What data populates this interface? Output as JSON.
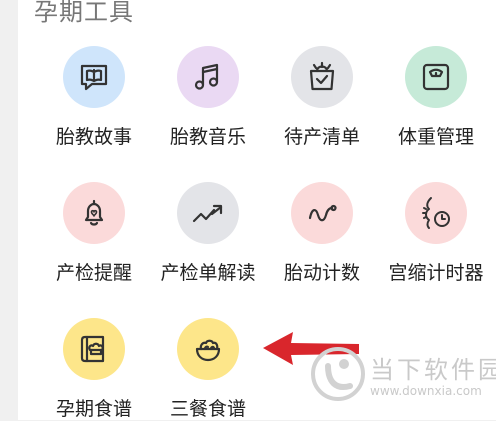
{
  "section": {
    "title": "孕期工具"
  },
  "tools": [
    {
      "label": "胎教故事",
      "icon": "book-chat-icon",
      "bg": "#cfe5fb"
    },
    {
      "label": "胎教音乐",
      "icon": "music-note-icon",
      "bg": "#ead9f3"
    },
    {
      "label": "待产清单",
      "icon": "shopping-bag-icon",
      "bg": "#e3e4e8"
    },
    {
      "label": "体重管理",
      "icon": "scale-icon",
      "bg": "#c6ead8"
    },
    {
      "label": "产检提醒",
      "icon": "bell-icon",
      "bg": "#fbdada"
    },
    {
      "label": "产检单解读",
      "icon": "trend-up-icon",
      "bg": "#e3e4e8"
    },
    {
      "label": "胎动计数",
      "icon": "fetal-movement-icon",
      "bg": "#fbdada"
    },
    {
      "label": "宫缩计时器",
      "icon": "contraction-timer-icon",
      "bg": "#fbdada"
    },
    {
      "label": "孕期食谱",
      "icon": "recipe-book-icon",
      "bg": "#fde68a"
    },
    {
      "label": "三餐食谱",
      "icon": "food-bowl-icon",
      "bg": "#fde68a"
    }
  ],
  "watermark": {
    "name": "当下软件园",
    "url": "www.downxia.com"
  },
  "colors": {
    "arrow": "#d9262c",
    "icon_stroke": "#333333"
  }
}
